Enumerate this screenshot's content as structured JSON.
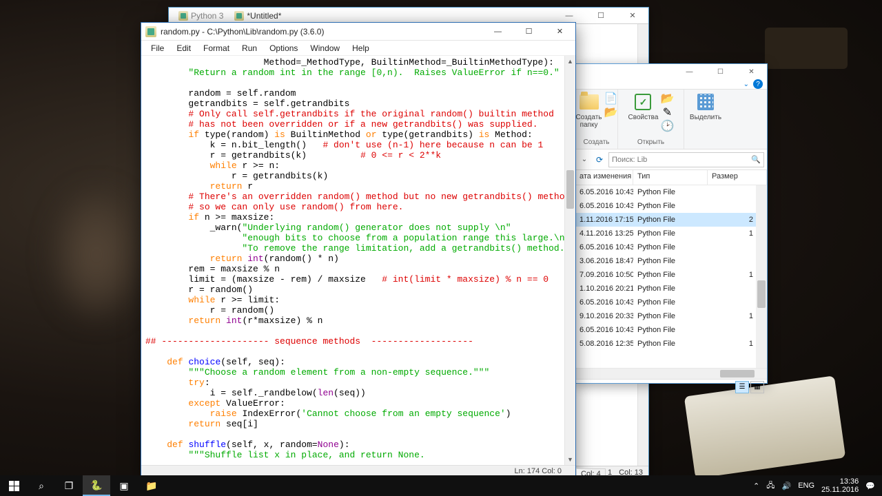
{
  "shell": {
    "tab1": "Python 3",
    "tab2": "*Untitled*",
    "status_ln": "Ln: 1",
    "status_col": "Col: 13",
    "status2": "Col: 4"
  },
  "editor": {
    "title": "random.py - C:\\Python\\Lib\\random.py (3.6.0)",
    "menu": {
      "file": "File",
      "edit": "Edit",
      "format": "Format",
      "run": "Run",
      "options": "Options",
      "window": "Window",
      "help": "Help"
    },
    "status": "Ln: 174   Col: 0"
  },
  "explorer": {
    "ribbon": {
      "newfolder": "Создать\nпапку",
      "group_new": "Создать",
      "props": "Свойства",
      "group_open": "Открыть",
      "select": "Выделить"
    },
    "search_placeholder": "Поиск: Lib",
    "headers": {
      "date": "ата изменения",
      "type": "Тип",
      "size": "Размер"
    },
    "rows": [
      {
        "date": "6.05.2016 10:43",
        "type": "Python File",
        "size": ""
      },
      {
        "date": "6.05.2016 10:43",
        "type": "Python File",
        "size": ""
      },
      {
        "date": "1.11.2016 17:15",
        "type": "Python File",
        "size": "2",
        "sel": true
      },
      {
        "date": "4.11.2016 13:25",
        "type": "Python File",
        "size": "1"
      },
      {
        "date": "6.05.2016 10:43",
        "type": "Python File",
        "size": ""
      },
      {
        "date": "3.06.2016 18:47",
        "type": "Python File",
        "size": ""
      },
      {
        "date": "7.09.2016 10:50",
        "type": "Python File",
        "size": "1"
      },
      {
        "date": "1.10.2016 20:21",
        "type": "Python File",
        "size": ""
      },
      {
        "date": "6.05.2016 10:43",
        "type": "Python File",
        "size": ""
      },
      {
        "date": "9.10.2016 20:33",
        "type": "Python File",
        "size": "1"
      },
      {
        "date": "6.05.2016 10:43",
        "type": "Python File",
        "size": ""
      },
      {
        "date": "5.08.2016 12:35",
        "type": "Python File",
        "size": "1"
      }
    ]
  },
  "tray": {
    "lang": "ENG",
    "time": "13:36",
    "date": "25.11.2016"
  },
  "code": {
    "l1a": "                      Method=_MethodType, BuiltinMethod=_BuiltinMethodType):",
    "l2": "        \"Return a random int in the range [0,n).  Raises ValueError if n==0.\"",
    "l3": "",
    "l4": "        random = self.random",
    "l5": "        getrandbits = self.getrandbits",
    "l6": "        # Only call self.getrandbits if the original random() builtin method",
    "l7": "        # has not been overridden or if a new getrandbits() was supplied.",
    "l8a": "        ",
    "l8b": "if",
    "l8c": " type(random) ",
    "l8d": "is",
    "l8e": " BuiltinMethod ",
    "l8f": "or",
    "l8g": " type(getrandbits) ",
    "l8h": "is",
    "l8i": " Method:",
    "l9a": "            k = n.bit_length()   ",
    "l9b": "# don't use (n-1) here because n can be 1",
    "l10a": "            r = getrandbits(k)          ",
    "l10b": "# 0 <= r < 2**k",
    "l11a": "            ",
    "l11b": "while",
    "l11c": " r >= n:",
    "l12": "                r = getrandbits(k)",
    "l13a": "            ",
    "l13b": "return",
    "l13c": " r",
    "l14": "        # There's an overridden random() method but no new getrandbits() method,",
    "l15": "        # so we can only use random() from here.",
    "l16a": "        ",
    "l16b": "if",
    "l16c": " n >= maxsize:",
    "l17a": "            _warn(",
    "l17b": "\"Underlying random() generator does not supply \\n\"",
    "l18": "                  \"enough bits to choose from a population range this large.\\n\"",
    "l19a": "                  \"To remove the range limitation, add a getrandbits() method.\"",
    "l19b": ")",
    "l20a": "            ",
    "l20b": "return",
    "l20c": " ",
    "l20d": "int",
    "l20e": "(random() * n)",
    "l21": "        rem = maxsize % n",
    "l22a": "        limit = (maxsize - rem) / maxsize   ",
    "l22b": "# int(limit * maxsize) % n == 0",
    "l23": "        r = random()",
    "l24a": "        ",
    "l24b": "while",
    "l24c": " r >= limit:",
    "l25": "            r = random()",
    "l26a": "        ",
    "l26b": "return",
    "l26c": " ",
    "l26d": "int",
    "l26e": "(r*maxsize) % n",
    "l27": "",
    "l28": "## -------------------- sequence methods  -------------------",
    "l29": "",
    "l30a": "    ",
    "l30b": "def",
    "l30c": " ",
    "l30d": "choice",
    "l30e": "(self, seq):",
    "l31": "        \"\"\"Choose a random element from a non-empty sequence.\"\"\"",
    "l32a": "        ",
    "l32b": "try",
    "l32c": ":",
    "l33a": "            i = self._randbelow(",
    "l33b": "len",
    "l33c": "(seq))",
    "l34a": "        ",
    "l34b": "except",
    "l34c": " ValueError:",
    "l35a": "            ",
    "l35b": "raise",
    "l35c": " IndexError(",
    "l35d": "'Cannot choose from an empty sequence'",
    "l35e": ")",
    "l36a": "        ",
    "l36b": "return",
    "l36c": " seq[i]",
    "l37": "",
    "l38a": "    ",
    "l38b": "def",
    "l38c": " ",
    "l38d": "shuffle",
    "l38e": "(self, x, random=",
    "l38f": "None",
    "l38g": "):",
    "l39": "        \"\"\"Shuffle list x in place, and return None."
  }
}
